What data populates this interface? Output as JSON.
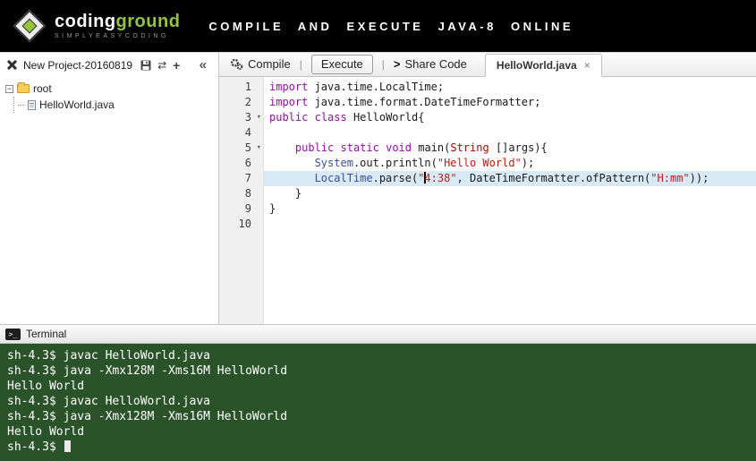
{
  "header": {
    "logo_coding": "coding",
    "logo_ground": "ground",
    "logo_sub": "SIMPLYEASYCODING",
    "title": "COMPILE AND EXECUTE JAVA-8 ONLINE"
  },
  "project_panel": {
    "name": "New Project-20160819"
  },
  "file_tree": {
    "root_label": "root",
    "file_label": "HelloWorld.java"
  },
  "toolbar": {
    "compile_label": "Compile",
    "execute_label": "Execute",
    "share_label": "Share Code",
    "separator": "|"
  },
  "tab": {
    "label": "HelloWorld.java",
    "close_glyph": "×"
  },
  "icons": {
    "share": ">",
    "collapse": "«",
    "sync": "⇄",
    "add": "+",
    "fold": "▾",
    "expander": "−",
    "terminal": ">_"
  },
  "colors": {
    "accent_green": "#94c33d",
    "keyword": "#930FA7",
    "string": "#C41A16",
    "support_class": "#3C4C9E",
    "type": "#B00000",
    "active_line": "#d9eaf7",
    "terminal_bg": "#2B5329"
  },
  "editor": {
    "lines": [
      {
        "n": "1",
        "fold": false,
        "active": false,
        "tokens": [
          {
            "c": "kw",
            "t": "import"
          },
          {
            "c": "pl",
            "t": " java.time.LocalTime;"
          }
        ]
      },
      {
        "n": "2",
        "fold": false,
        "active": false,
        "tokens": [
          {
            "c": "kw",
            "t": "import"
          },
          {
            "c": "pl",
            "t": " java.time.format.DateTimeFormatter;"
          }
        ]
      },
      {
        "n": "3",
        "fold": true,
        "active": false,
        "tokens": [
          {
            "c": "kw",
            "t": "public"
          },
          {
            "c": "pl",
            "t": " "
          },
          {
            "c": "kw",
            "t": "class"
          },
          {
            "c": "pl",
            "t": " HelloWorld{"
          }
        ]
      },
      {
        "n": "4",
        "fold": false,
        "active": false,
        "tokens": []
      },
      {
        "n": "5",
        "fold": true,
        "active": false,
        "tokens": [
          {
            "c": "pl",
            "t": "    "
          },
          {
            "c": "kw",
            "t": "public"
          },
          {
            "c": "pl",
            "t": " "
          },
          {
            "c": "kw",
            "t": "static"
          },
          {
            "c": "pl",
            "t": " "
          },
          {
            "c": "kw",
            "t": "void"
          },
          {
            "c": "pl",
            "t": " main("
          },
          {
            "c": "typ",
            "t": "String"
          },
          {
            "c": "pl",
            "t": " []args){"
          }
        ]
      },
      {
        "n": "6",
        "fold": false,
        "active": false,
        "tokens": [
          {
            "c": "pl",
            "t": "       "
          },
          {
            "c": "sup",
            "t": "System"
          },
          {
            "c": "pl",
            "t": ".out.println("
          },
          {
            "c": "str",
            "t": "\"Hello World\""
          },
          {
            "c": "pl",
            "t": ");"
          }
        ]
      },
      {
        "n": "7",
        "fold": false,
        "active": true,
        "tokens": [
          {
            "c": "pl",
            "t": "       "
          },
          {
            "c": "sup",
            "t": "LocalTime"
          },
          {
            "c": "pl",
            "t": ".parse("
          },
          {
            "c": "str",
            "t": "\""
          },
          {
            "c": "caret",
            "t": ""
          },
          {
            "c": "str",
            "t": "4:38\""
          },
          {
            "c": "pl",
            "t": ", DateTimeFormatter.ofPattern("
          },
          {
            "c": "str",
            "t": "\"H:mm\""
          },
          {
            "c": "pl",
            "t": "));"
          }
        ]
      },
      {
        "n": "8",
        "fold": false,
        "active": false,
        "tokens": [
          {
            "c": "pl",
            "t": "    }"
          }
        ]
      },
      {
        "n": "9",
        "fold": false,
        "active": false,
        "tokens": [
          {
            "c": "pl",
            "t": "}"
          }
        ]
      },
      {
        "n": "10",
        "fold": false,
        "active": false,
        "tokens": []
      }
    ]
  },
  "terminal": {
    "title": "Terminal",
    "lines": [
      "sh-4.3$ javac HelloWorld.java",
      "sh-4.3$ java -Xmx128M -Xms16M HelloWorld",
      "Hello World",
      "sh-4.3$ javac HelloWorld.java",
      "sh-4.3$ java -Xmx128M -Xms16M HelloWorld",
      "Hello World",
      "sh-4.3$ "
    ]
  }
}
